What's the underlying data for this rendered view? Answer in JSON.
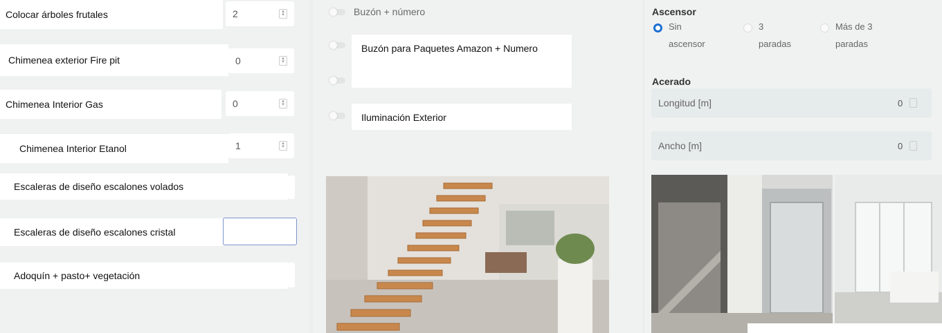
{
  "left_panel": {
    "rows": [
      {
        "label": "Colocar árboles frutales",
        "value": "2"
      },
      {
        "label": "Chimenea exterior Fire pit",
        "value": "0"
      },
      {
        "label": "Chimenea Interior Gas",
        "value": "0"
      },
      {
        "label": "Chimenea Interior Etanol",
        "value": "1"
      },
      {
        "label": "Escaleras de diseño escalones volados"
      },
      {
        "label": "Escaleras de diseño escalones cristal"
      },
      {
        "label": "Adoquín + pasto+ vegetación"
      }
    ]
  },
  "middle_panel": {
    "toggle_buzon": "Buzón + número",
    "toggle_amazon": "Buzón para Paquetes Amazon + Numero",
    "toggle_iluminacion": "Iluminación Exterior"
  },
  "right_panel": {
    "ascensor_heading": "Ascensor",
    "options": [
      {
        "line1": "Sin",
        "line2": "ascensor",
        "selected": true
      },
      {
        "line1": "3",
        "line2": "paradas",
        "selected": false
      },
      {
        "line1": "Más de 3",
        "line2": "paradas",
        "selected": false
      }
    ],
    "acerado_heading": "Acerado",
    "longitud_label": "Longitud [m]",
    "longitud_value": "0",
    "ancho_label": "Ancho [m]",
    "ancho_value": "0"
  },
  "colors": {
    "accent": "#1b6fd1",
    "panel": "#f0f1f1",
    "field": "#e6ebeb"
  }
}
